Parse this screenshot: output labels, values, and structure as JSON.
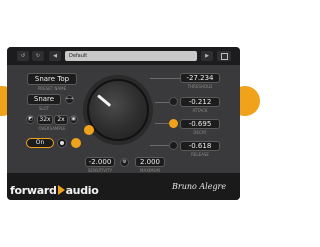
{
  "topbar": {
    "preset_label": "Default",
    "prev_symbol": "◀",
    "next_symbol": "▶",
    "undo_symbol": "↺",
    "redo_symbol": "↻",
    "save_symbol": "💾"
  },
  "left_panel": {
    "preset_value": "Snare Top",
    "preset_caption": "PRESET NAME",
    "slot_value": "Snare",
    "slot_caption": "SLOT",
    "oversample_left": "32x",
    "oversample_right": "2x",
    "oversample_caption": "OVERSAMPLE",
    "power_label": "On"
  },
  "center": {
    "value_left": "-2.000",
    "caption_left": "SENSITIVITY",
    "value_right": "2.000",
    "caption_right": "MAXIMUM",
    "knob_value": 0.37
  },
  "right_panel": {
    "rows": [
      {
        "value": "-27.234",
        "caption": "THRESHOLD"
      },
      {
        "value": "-0.212",
        "caption": "ATTACK"
      },
      {
        "value": "-0.695",
        "caption": "DECAY"
      },
      {
        "value": "-0.618",
        "caption": "RELEASE"
      }
    ]
  },
  "footer": {
    "brand_text": "forward",
    "brand_suffix": "audio",
    "signature": "Bruno Alegre"
  },
  "colors": {
    "accent": "#f0a21a",
    "panel": "#3a3a3c",
    "dark": "#1c1c1e"
  },
  "icons": [
    "chevron-left-icon",
    "chevron-right-icon",
    "undo-icon",
    "redo-icon",
    "save-icon",
    "power-icon",
    "link-icon",
    "settings-icon",
    "play-icon"
  ]
}
